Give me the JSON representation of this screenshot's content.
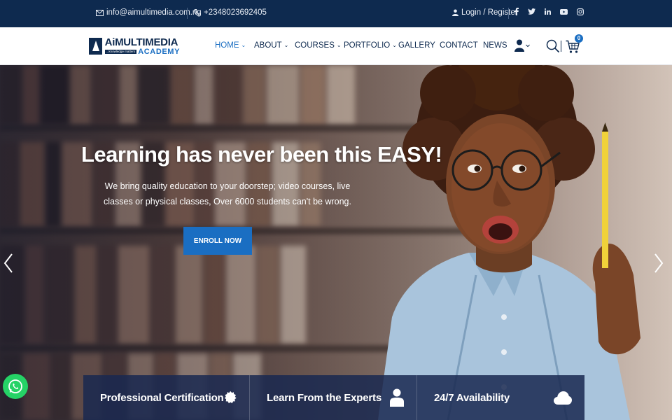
{
  "topbar": {
    "email": "info@aimultimedia.com.ng",
    "phone": "+2348023692405",
    "login": "Login / Register",
    "social_icons": [
      "facebook-icon",
      "twitter-icon",
      "linkedin-icon",
      "youtube-icon",
      "instagram-icon"
    ]
  },
  "brand": {
    "name_prefix": "Ai",
    "name_main": "MULTIMEDIA",
    "tagline": "...knowledge matters",
    "academy": "ACADEMY"
  },
  "nav": {
    "items": [
      {
        "label": "HOME",
        "dropdown": true,
        "active": true
      },
      {
        "label": "ABOUT",
        "dropdown": true
      },
      {
        "label": "COURSES",
        "dropdown": true
      },
      {
        "label": "PORTFOLIO",
        "dropdown": true
      },
      {
        "label": "GALLERY",
        "dropdown": false
      },
      {
        "label": "CONTACT",
        "dropdown": false
      },
      {
        "label": "NEWS",
        "dropdown": false
      }
    ],
    "cart_count": "0",
    "icons": [
      "user-icon",
      "search-icon",
      "cart-icon"
    ]
  },
  "hero": {
    "title": "Learning has never been this EASY!",
    "subtitle": "We bring quality education to your doorstep; video courses, live classes or physical classes, Over 6000 students can't be wrong.",
    "cta": "ENROLL NOW"
  },
  "features": [
    {
      "label": "Professional Certification",
      "icon": "certificate-badge-icon"
    },
    {
      "label": "Learn From the Experts",
      "icon": "user-icon"
    },
    {
      "label": "24/7 Availability",
      "icon": "cloud-icon"
    }
  ],
  "colors": {
    "navy": "#0e2a4f",
    "accent": "#1a6ec2",
    "whatsapp": "#25d366"
  }
}
